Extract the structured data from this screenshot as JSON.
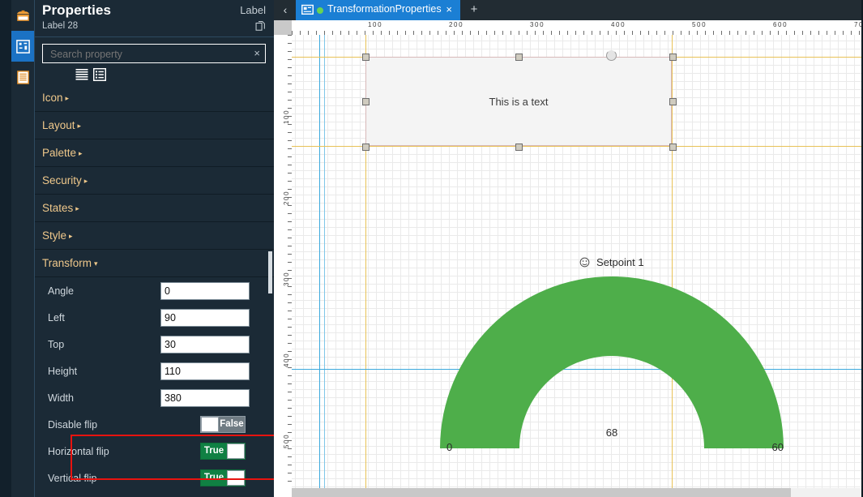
{
  "rail": {
    "items": [
      {
        "name": "toolbox-icon",
        "label": "Toolbox",
        "active": false
      },
      {
        "name": "properties-icon",
        "label": "Properties",
        "active": true
      },
      {
        "name": "list-icon",
        "label": "Outline",
        "active": false
      }
    ]
  },
  "panel": {
    "title": "Properties",
    "subtitle": "Label 28",
    "type_label": "Label",
    "copy_icon": "copy-icon",
    "search": {
      "placeholder": "Search property",
      "value": "",
      "clear_label": "×"
    },
    "view_toggles": [
      {
        "name": "list-view-icon",
        "label": "List view"
      },
      {
        "name": "grouped-view-icon",
        "label": "Grouped view"
      }
    ],
    "categories": [
      {
        "label": "Icon",
        "arrow": "▸",
        "expanded": false
      },
      {
        "label": "Layout",
        "arrow": "▸",
        "expanded": false
      },
      {
        "label": "Palette",
        "arrow": "▸",
        "expanded": false
      },
      {
        "label": "Security",
        "arrow": "▸",
        "expanded": false
      },
      {
        "label": "States",
        "arrow": "▸",
        "expanded": false
      },
      {
        "label": "Style",
        "arrow": "▸",
        "expanded": false
      },
      {
        "label": "Transform",
        "arrow": "▾",
        "expanded": true
      }
    ],
    "transform_fields": [
      {
        "label": "Angle",
        "value": "0",
        "kind": "text"
      },
      {
        "label": "Left",
        "value": "90",
        "kind": "text"
      },
      {
        "label": "Top",
        "value": "30",
        "kind": "text"
      },
      {
        "label": "Height",
        "value": "110",
        "kind": "text"
      },
      {
        "label": "Width",
        "value": "380",
        "kind": "text"
      },
      {
        "label": "Disable flip",
        "value": "False",
        "kind": "toggle",
        "on": false
      },
      {
        "label": "Horizontal flip",
        "value": "True",
        "kind": "toggle",
        "on": true
      },
      {
        "label": "Vertical flip",
        "value": "True",
        "kind": "toggle",
        "on": true
      }
    ],
    "highlight_color": "#e8130f"
  },
  "editor": {
    "back_arrow": "‹",
    "add_tab": "+",
    "tabs": [
      {
        "label": "TransformationProperties",
        "close": "×",
        "status_dot_color": "#67d455",
        "active": true
      }
    ],
    "ruler_h_labels": [
      "100",
      "200",
      "300",
      "400",
      "500",
      "600",
      "70"
    ],
    "ruler_v_labels": [
      "100",
      "200",
      "300",
      "400",
      "500"
    ],
    "canvas": {
      "textbox": {
        "text": "This is a text"
      },
      "gauge": {
        "title": "Setpoint 1",
        "icon": "setpoint-gauge-icon",
        "min": "0",
        "max": "60",
        "value": "68",
        "color": "#4eae4a"
      },
      "guides": {
        "yellow": "#e8c257",
        "blue": "#3ca9dd"
      }
    }
  }
}
